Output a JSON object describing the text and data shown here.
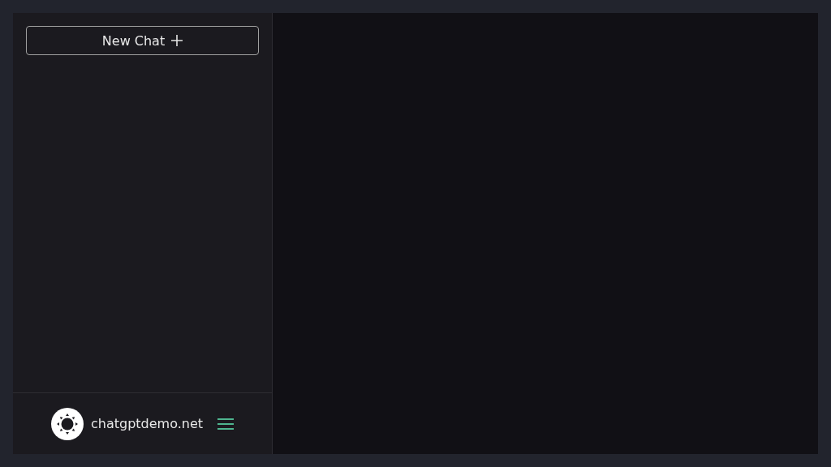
{
  "sidebar": {
    "new_chat_button": {
      "label": "New Chat"
    },
    "footer": {
      "site_name": "chatgptdemo.net"
    }
  }
}
